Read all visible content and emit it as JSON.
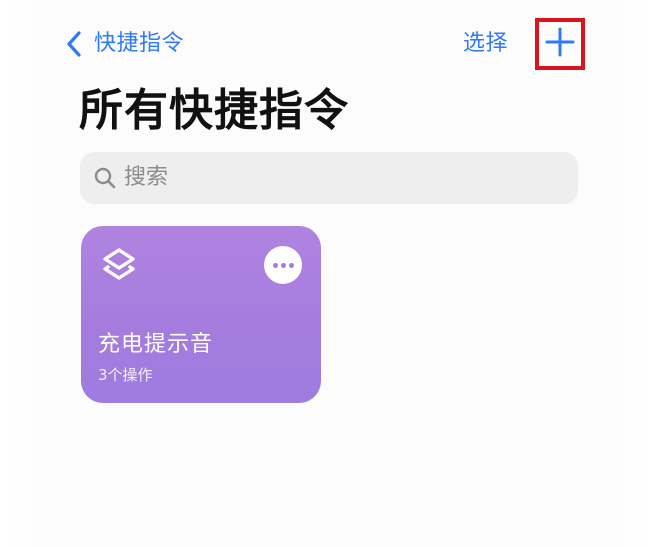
{
  "nav": {
    "back_label": "快捷指令",
    "select_label": "选择",
    "add_icon": "plus-icon",
    "back_icon": "chevron-left-icon",
    "accent_color": "#2f7af6",
    "highlight_color": "#d9141c"
  },
  "page": {
    "title": "所有快捷指令"
  },
  "search": {
    "placeholder": "搜索",
    "icon": "search-icon"
  },
  "shortcuts": [
    {
      "name": "充电提示音",
      "subtitle": "3个操作",
      "icon": "layers-icon",
      "more_icon": "more-icon",
      "color": "#a57cde"
    }
  ]
}
